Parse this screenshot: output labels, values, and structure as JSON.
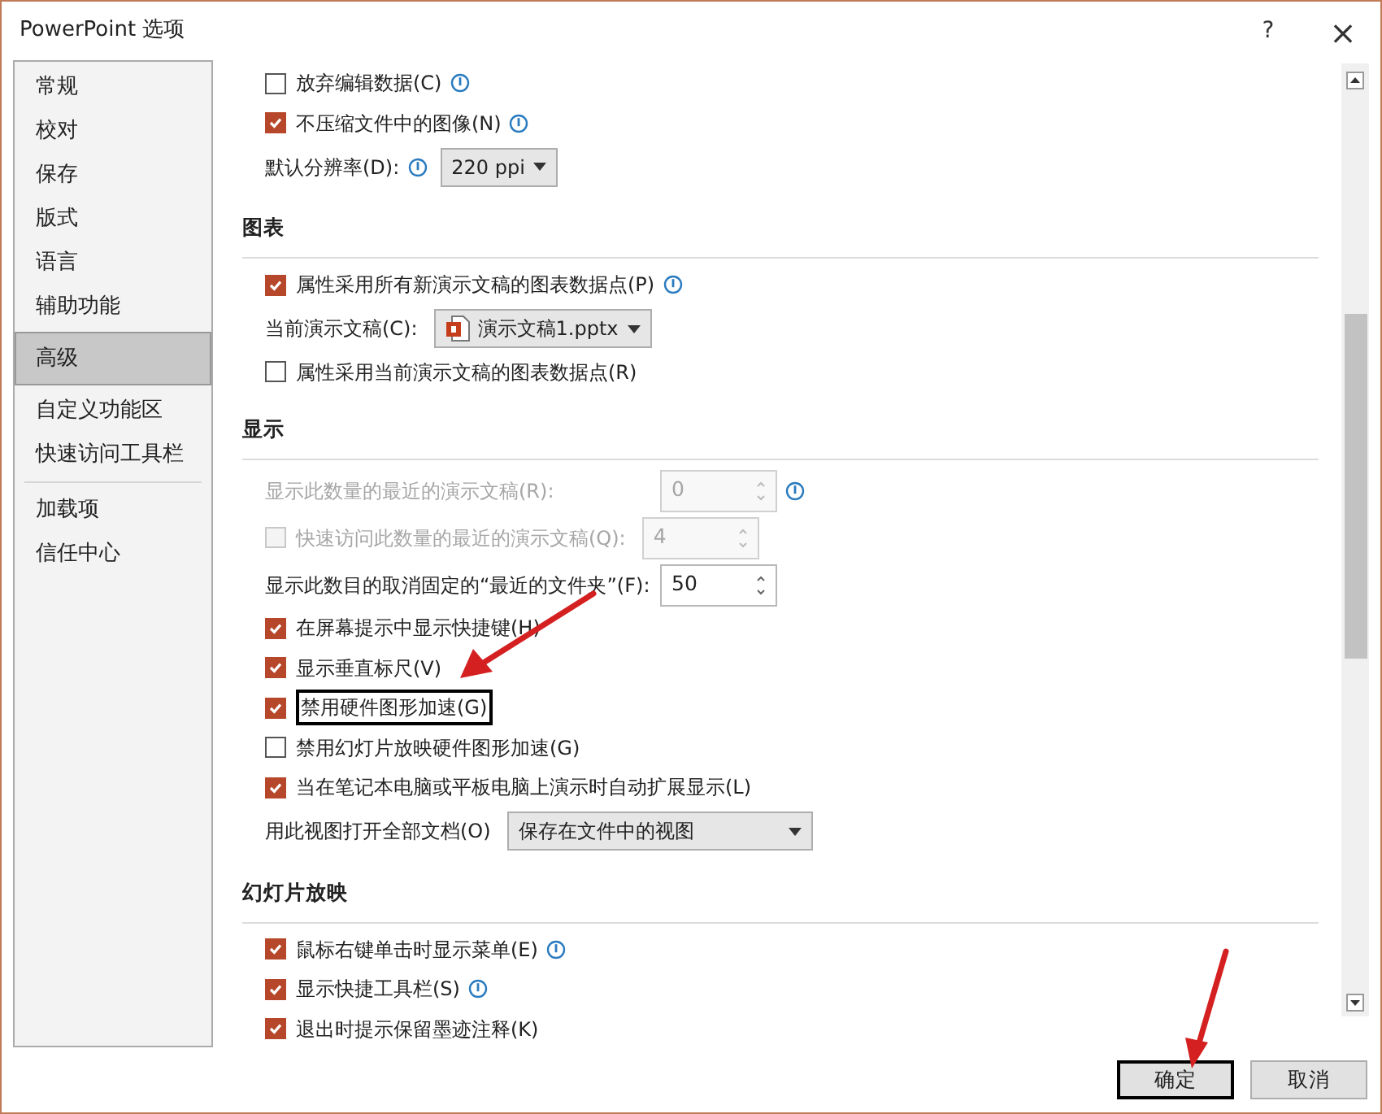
{
  "window": {
    "title": "PowerPoint 选项",
    "help": "?",
    "close": "×"
  },
  "sidebar": {
    "items": [
      {
        "label": "常规",
        "selected": false
      },
      {
        "label": "校对",
        "selected": false
      },
      {
        "label": "保存",
        "selected": false
      },
      {
        "label": "版式",
        "selected": false
      },
      {
        "label": "语言",
        "selected": false
      },
      {
        "label": "辅助功能",
        "selected": false
      },
      {
        "label": "高级",
        "selected": true
      },
      {
        "label": "自定义功能区",
        "selected": false
      },
      {
        "label": "快速访问工具栏",
        "selected": false,
        "separator_after": true
      },
      {
        "label": "加载项",
        "selected": false
      },
      {
        "label": "信任中心",
        "selected": false
      }
    ]
  },
  "settings": [
    {
      "kind": "checkbox",
      "label": "放弃编辑数据(C)",
      "checked": false,
      "info": true
    },
    {
      "kind": "checkbox",
      "label": "不压缩文件中的图像(N)",
      "checked": true,
      "info": true
    },
    {
      "kind": "dropdown",
      "label": "默认分辨率(D):",
      "info": true,
      "value": "220 ppi"
    },
    {
      "kind": "heading",
      "label": "图表"
    },
    {
      "kind": "checkbox",
      "label": "属性采用所有新演示文稿的图表数据点(P)",
      "checked": true,
      "info": true
    },
    {
      "kind": "file-dropdown",
      "label": "当前演示文稿(C):",
      "value": "演示文稿1.pptx"
    },
    {
      "kind": "checkbox",
      "label": "属性采用当前演示文稿的图表数据点(R)",
      "checked": false
    },
    {
      "kind": "heading",
      "label": "显示"
    },
    {
      "kind": "spin",
      "label": "显示此数量的最近的演示文稿(R):",
      "value": "0",
      "disabled": true,
      "info": true
    },
    {
      "kind": "checkbox-spin",
      "label": "快速访问此数量的最近的演示文稿(Q):",
      "checked": false,
      "value": "4",
      "disabled": true
    },
    {
      "kind": "spin",
      "label": "显示此数目的取消固定的“最近的文件夹”(F):",
      "value": "50",
      "disabled": false
    },
    {
      "kind": "checkbox",
      "label": "在屏幕提示中显示快捷键(H)",
      "checked": true
    },
    {
      "kind": "checkbox",
      "label": "显示垂直标尺(V)",
      "checked": true
    },
    {
      "kind": "checkbox",
      "label": "禁用硬件图形加速(G)",
      "checked": true,
      "highlighted": true
    },
    {
      "kind": "checkbox",
      "label": "禁用幻灯片放映硬件图形加速(G)",
      "checked": false
    },
    {
      "kind": "checkbox",
      "label": "当在笔记本电脑或平板电脑上演示时自动扩展显示(L)",
      "checked": true
    },
    {
      "kind": "dropdown",
      "label": "用此视图打开全部文档(O)",
      "value": "保存在文件中的视图",
      "wide": true
    },
    {
      "kind": "heading",
      "label": "幻灯片放映"
    },
    {
      "kind": "checkbox",
      "label": "鼠标右键单击时显示菜单(E)",
      "checked": true,
      "info": true
    },
    {
      "kind": "checkbox",
      "label": "显示快捷工具栏(S)",
      "checked": true,
      "info": true
    },
    {
      "kind": "checkbox",
      "label": "退出时提示保留墨迹注释(K)",
      "checked": true
    }
  ],
  "buttons": [
    {
      "label": "确定",
      "highlighted": true
    },
    {
      "label": "取消",
      "highlighted": false
    }
  ]
}
